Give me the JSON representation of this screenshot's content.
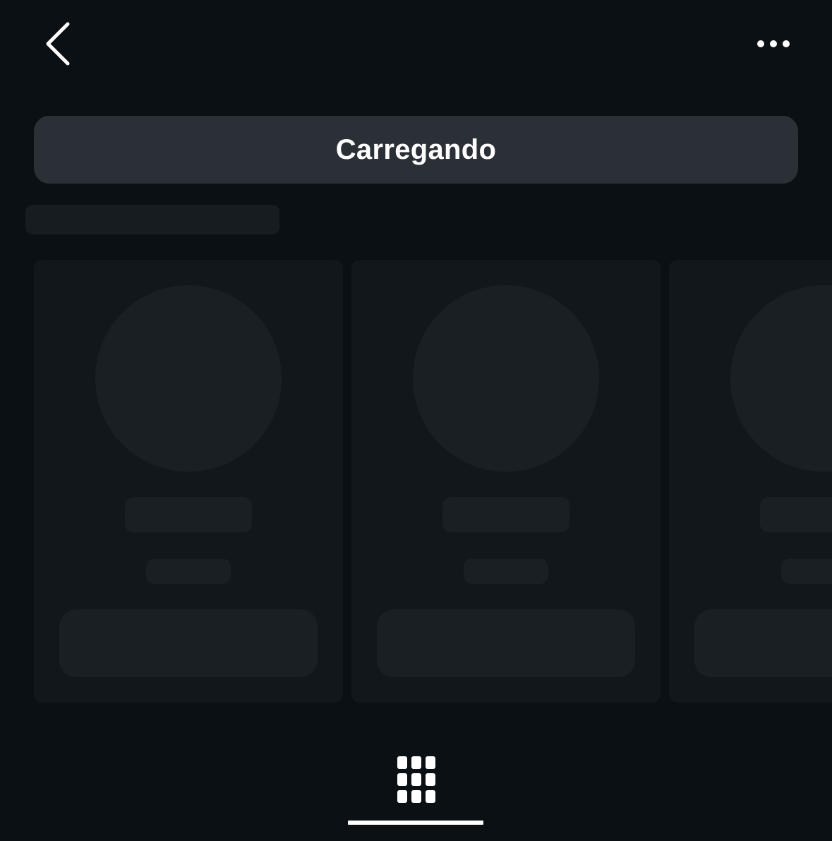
{
  "header": {
    "back_icon": "chevron-left-icon",
    "more_icon": "more-horizontal-icon"
  },
  "status": {
    "text": "Carregando"
  },
  "tabs": [
    {
      "icon": "grid-icon",
      "active": true
    }
  ],
  "colors": {
    "background": "#0b1014",
    "status_bar": "#2b3037",
    "card": "#12171b",
    "skeleton": "#1a1f23",
    "foreground": "#ffffff"
  }
}
